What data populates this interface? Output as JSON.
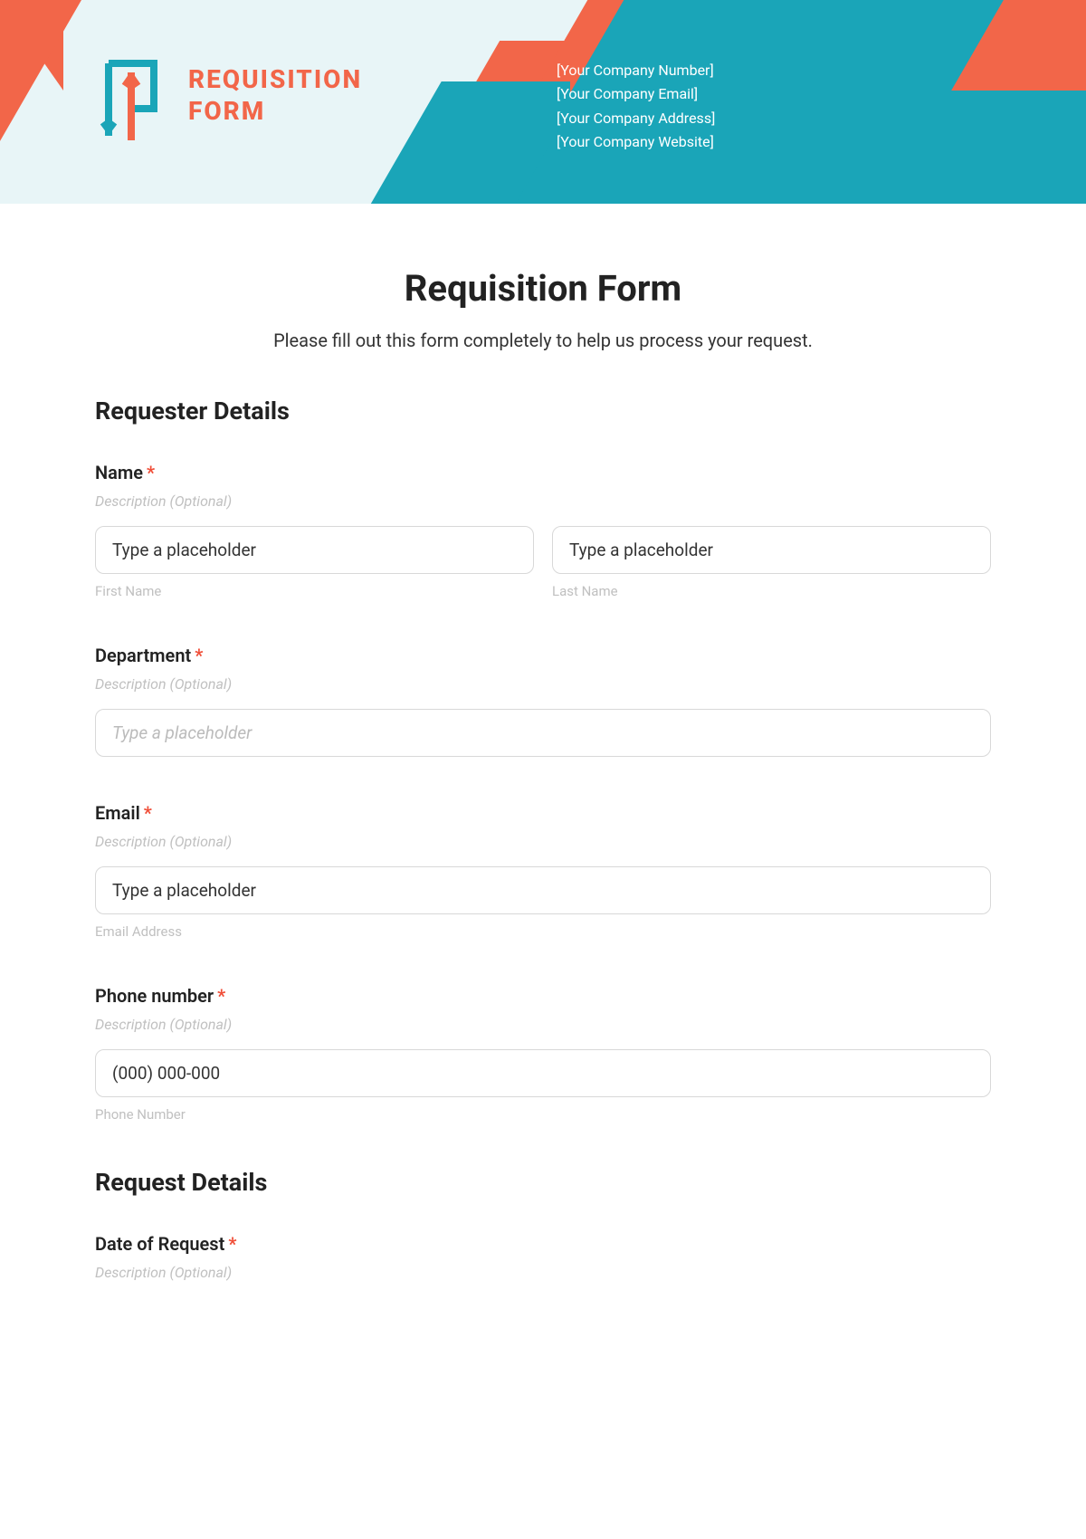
{
  "header": {
    "logo_line1": "REQUISITION",
    "logo_line2": "FORM",
    "company": {
      "number": "[Your Company Number]",
      "email": "[Your Company Email]",
      "address": "[Your Company Address]",
      "website": "[Your Company Website]"
    }
  },
  "form": {
    "title": "Requisition Form",
    "subtitle": "Please fill out this form completely to help us process your request.",
    "required_mark": "*",
    "sections": {
      "requester": {
        "title": "Requester Details",
        "name": {
          "label": "Name",
          "description": "Description (Optional)",
          "first_placeholder": "Type a placeholder",
          "first_sublabel": "First Name",
          "last_placeholder": "Type a placeholder",
          "last_sublabel": "Last Name"
        },
        "department": {
          "label": "Department",
          "description": "Description (Optional)",
          "placeholder": "Type a placeholder"
        },
        "email": {
          "label": "Email",
          "description": "Description (Optional)",
          "placeholder": "Type a placeholder",
          "sublabel": "Email Address"
        },
        "phone": {
          "label": "Phone number",
          "description": "Description (Optional)",
          "placeholder": "(000) 000-000",
          "sublabel": "Phone Number"
        }
      },
      "request": {
        "title": "Request Details",
        "date": {
          "label": "Date of Request",
          "description": "Description (Optional)"
        }
      }
    }
  }
}
